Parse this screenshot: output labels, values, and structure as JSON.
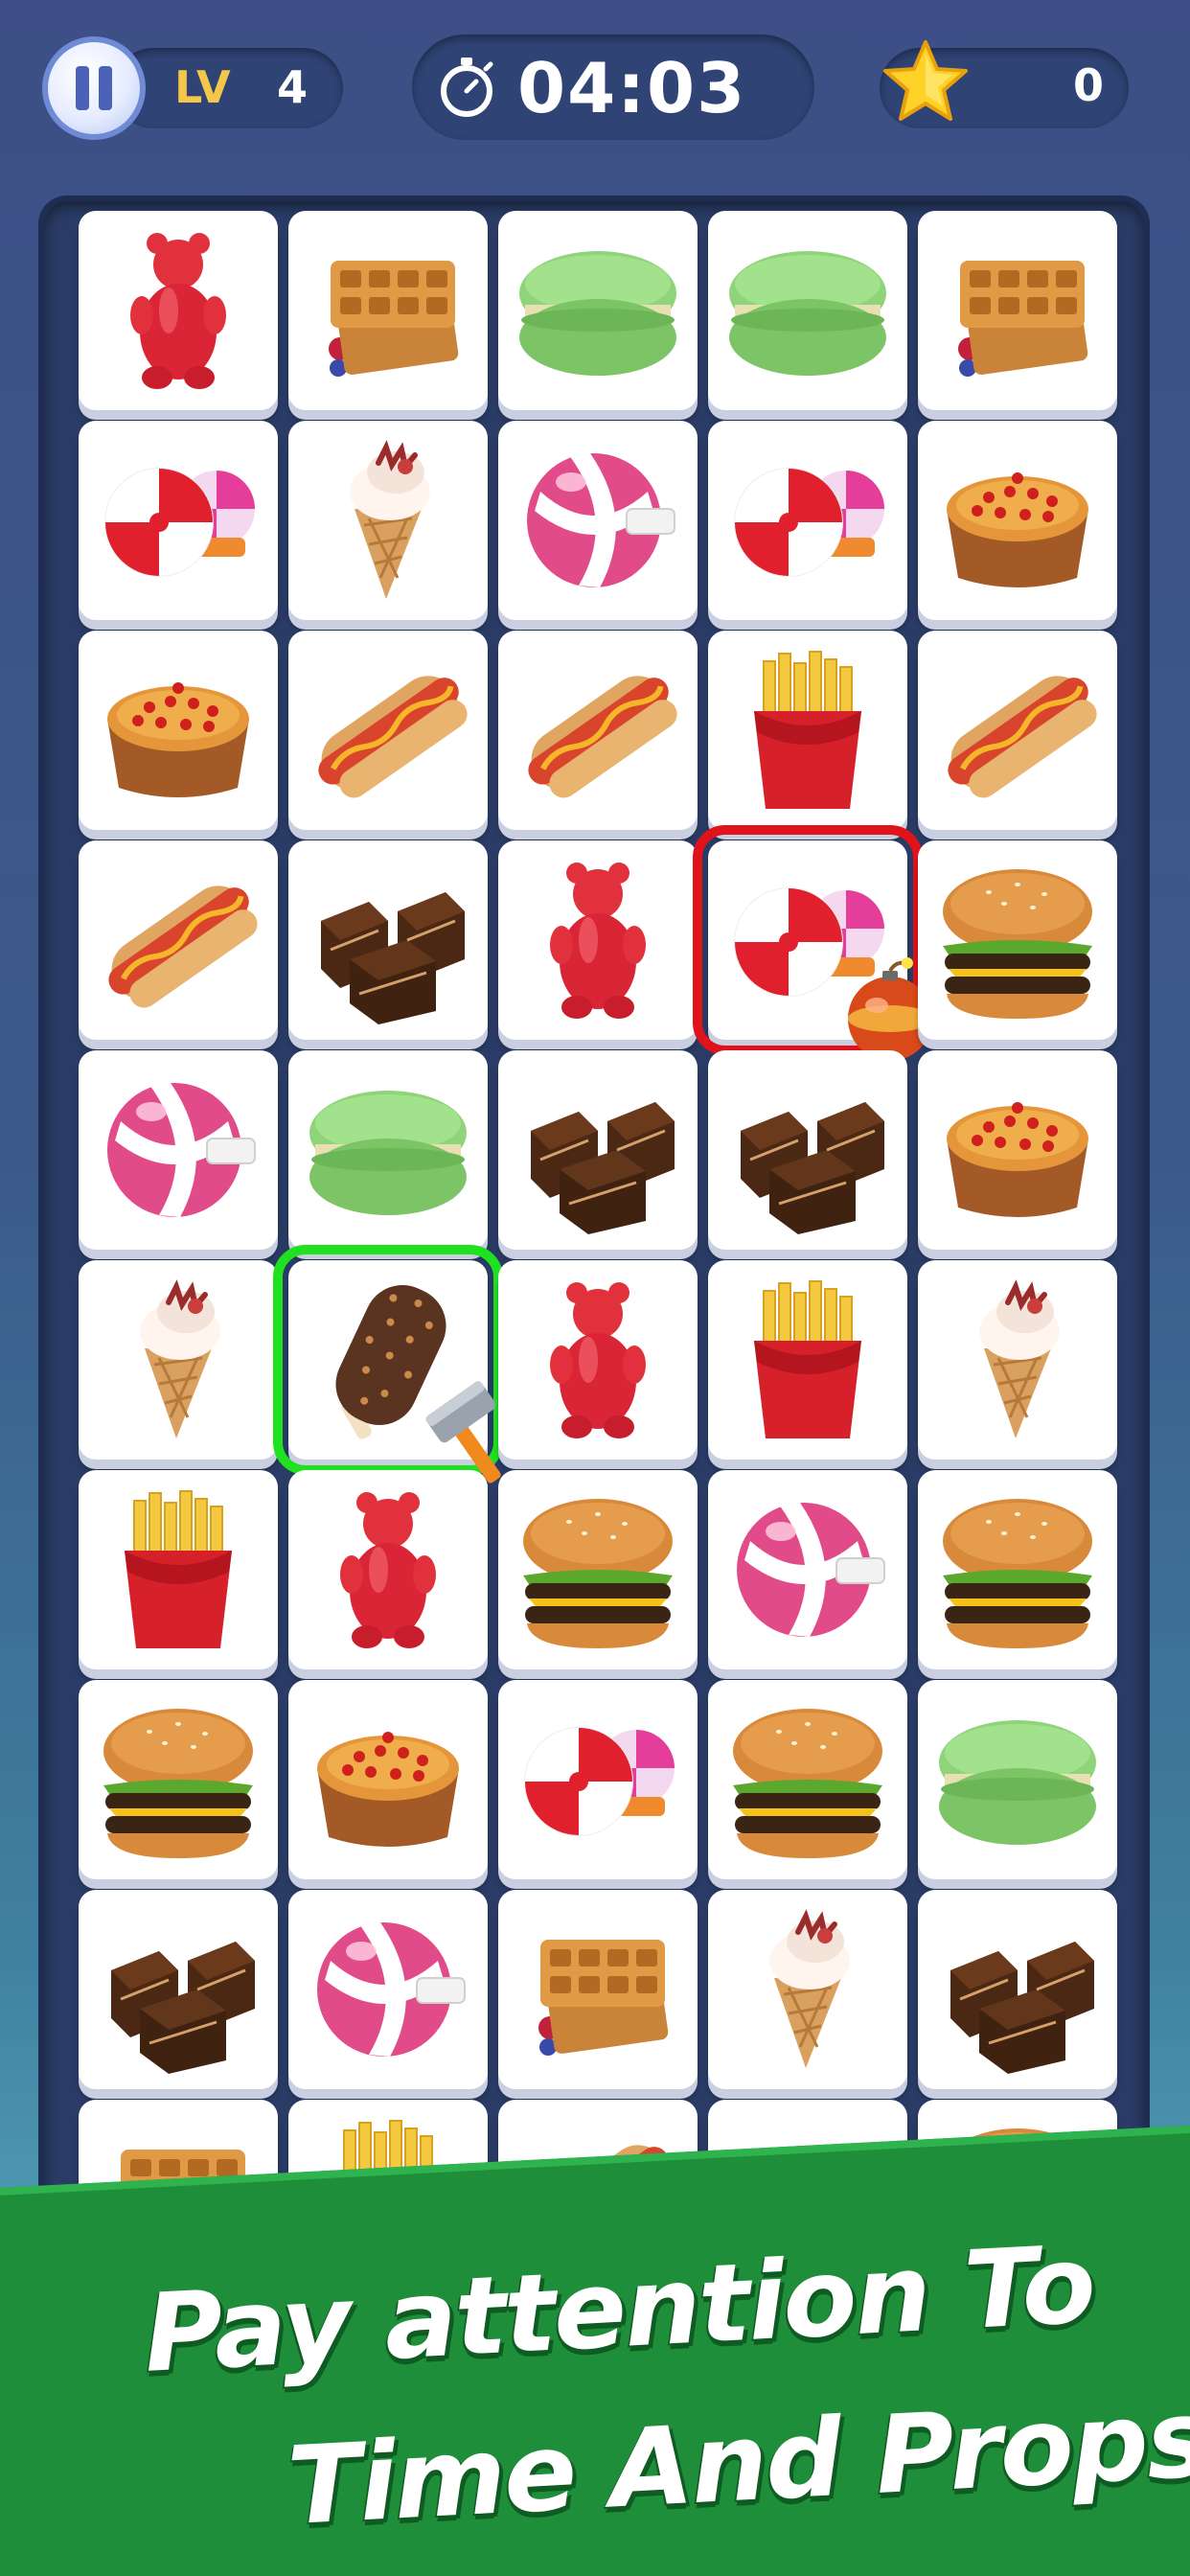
{
  "hud": {
    "level_label": "LV",
    "level_value": "4",
    "timer": "04:03",
    "score": "0"
  },
  "board": {
    "rows": [
      [
        "gummy-bear",
        "waffle",
        "macaron",
        "macaron",
        "waffle"
      ],
      [
        "peppermint-candy",
        "ice-cream-cone",
        "candy-ball",
        "peppermint-candy",
        "cherry-pie"
      ],
      [
        "cherry-pie",
        "hot-dog",
        "hot-dog",
        "french-fries",
        "hot-dog"
      ],
      [
        "hot-dog",
        "chocolate-brownie",
        "gummy-bear",
        "peppermint-candy",
        "burger"
      ],
      [
        "candy-ball",
        "macaron",
        "chocolate-brownie",
        "chocolate-brownie",
        "cherry-pie"
      ],
      [
        "ice-cream-cone",
        "chocolate-ice-bar",
        "gummy-bear",
        "french-fries",
        "ice-cream-cone"
      ],
      [
        "french-fries",
        "gummy-bear",
        "burger",
        "candy-ball",
        "burger"
      ],
      [
        "burger",
        "cherry-pie",
        "peppermint-candy",
        "burger",
        "macaron"
      ],
      [
        "chocolate-brownie",
        "candy-ball",
        "waffle",
        "ice-cream-cone",
        "chocolate-brownie"
      ],
      [
        "waffle",
        "french-fries",
        "hot-dog",
        "hot-dog",
        "burger"
      ]
    ],
    "highlights": [
      {
        "row": 3,
        "col": 3,
        "color": "#e0131a",
        "prop": "bomb-icon"
      },
      {
        "row": 5,
        "col": 1,
        "color": "#1fe11f",
        "prop": "hammer-icon"
      }
    ]
  },
  "banner": {
    "line1": "Pay attention To",
    "line2": "Time And Props"
  },
  "colors": {
    "banner_green": "#1f8e3a",
    "level_gold": "#f4c64a",
    "bomb_highlight": "#e0131a",
    "hammer_highlight": "#1fe11f"
  }
}
